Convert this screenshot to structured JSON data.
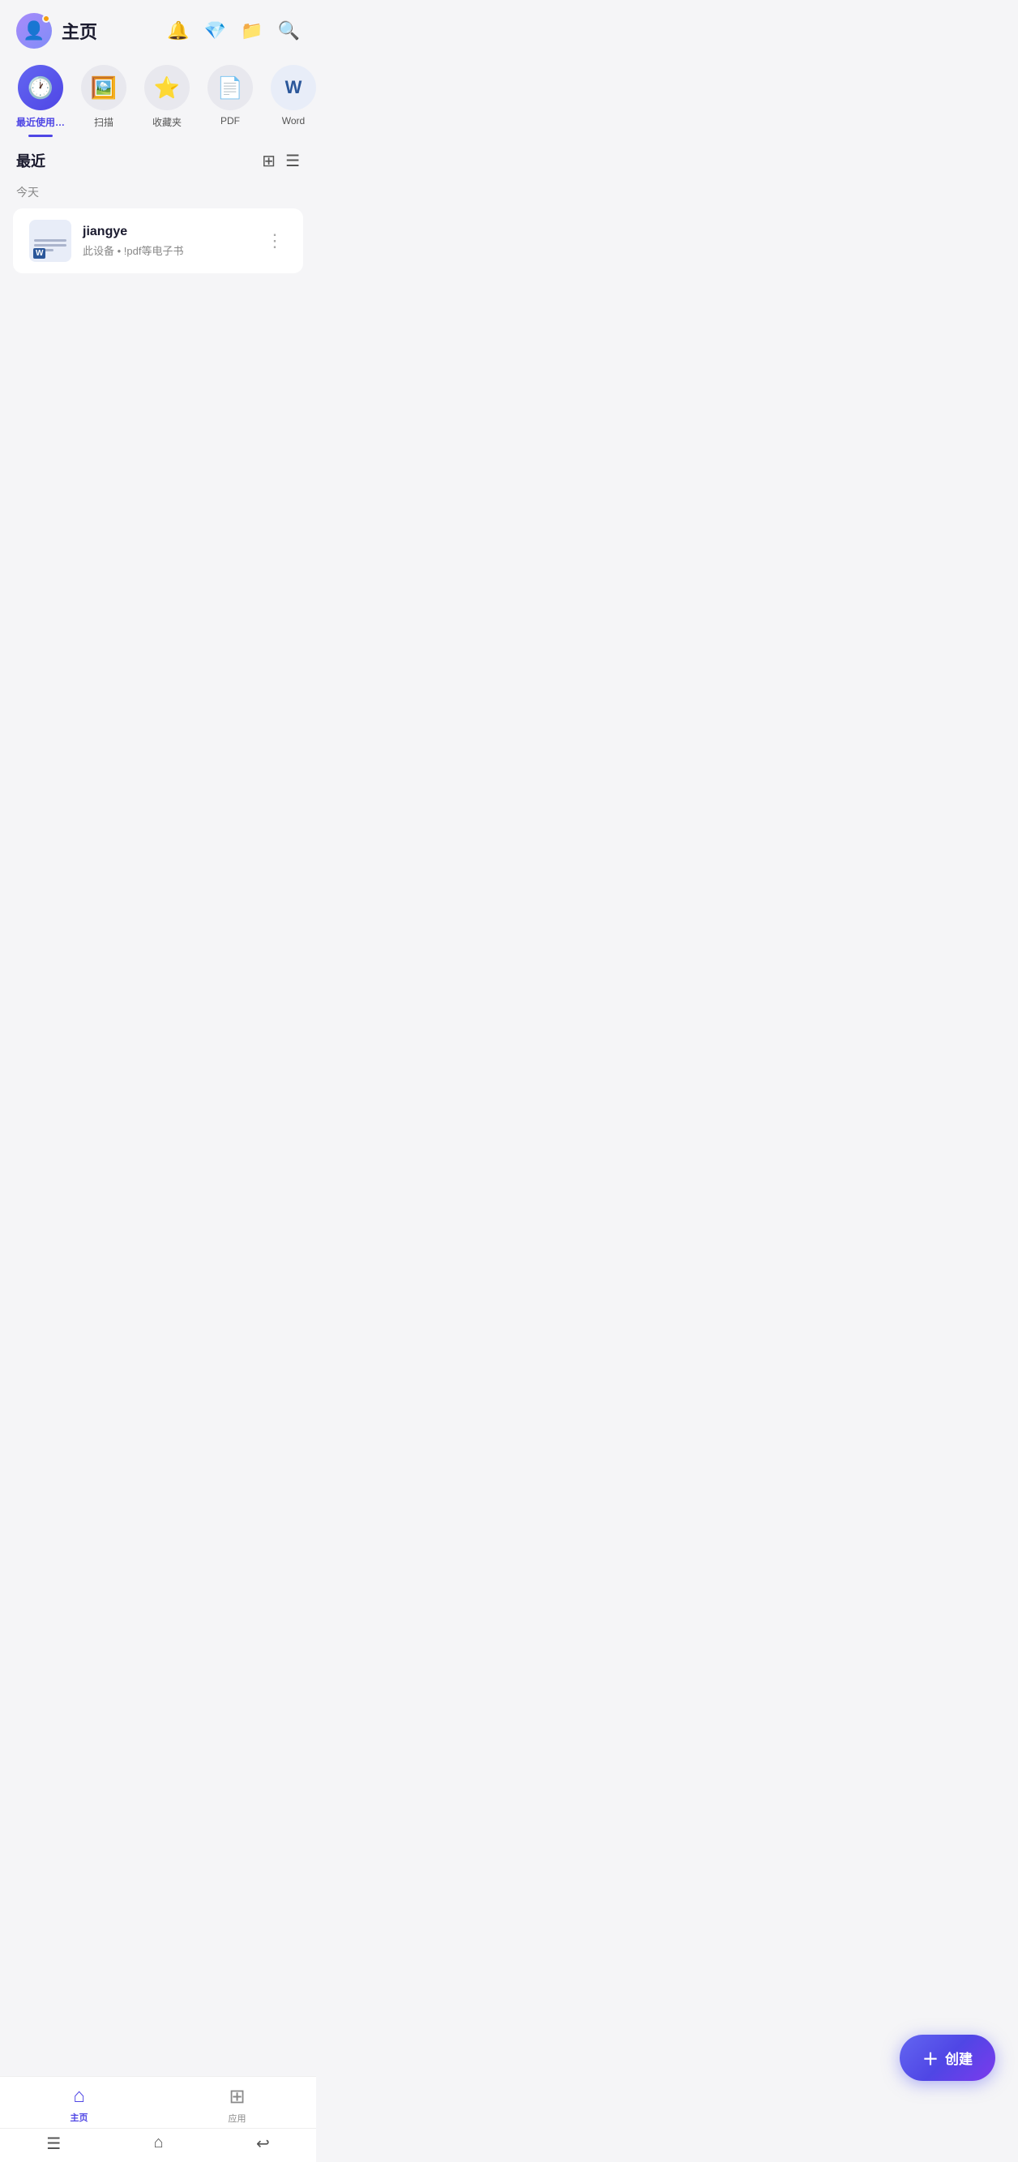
{
  "header": {
    "title": "主页",
    "avatar_alt": "user avatar"
  },
  "categories": [
    {
      "id": "recent",
      "label": "最近使用…",
      "icon": "🕐",
      "active": true
    },
    {
      "id": "scan",
      "label": "扫描",
      "icon": "🖼️",
      "active": false
    },
    {
      "id": "favorites",
      "label": "收藏夹",
      "icon": "⭐",
      "active": false
    },
    {
      "id": "pdf",
      "label": "PDF",
      "icon": "📄",
      "active": false
    },
    {
      "id": "word",
      "label": "Word",
      "icon": "W",
      "active": false
    }
  ],
  "section": {
    "title": "最近",
    "date_label": "今天"
  },
  "files": [
    {
      "name": "jiangye",
      "meta": "此设备  •  !pdf等电子书",
      "type": "word"
    }
  ],
  "create_button": {
    "label": "创建",
    "icon": "+"
  },
  "bottom_nav": [
    {
      "id": "home",
      "label": "主页",
      "active": true
    },
    {
      "id": "apps",
      "label": "应用",
      "active": false
    }
  ],
  "system_bar": {
    "menu_icon": "☰",
    "home_icon": "⌂",
    "back_icon": "↩"
  }
}
